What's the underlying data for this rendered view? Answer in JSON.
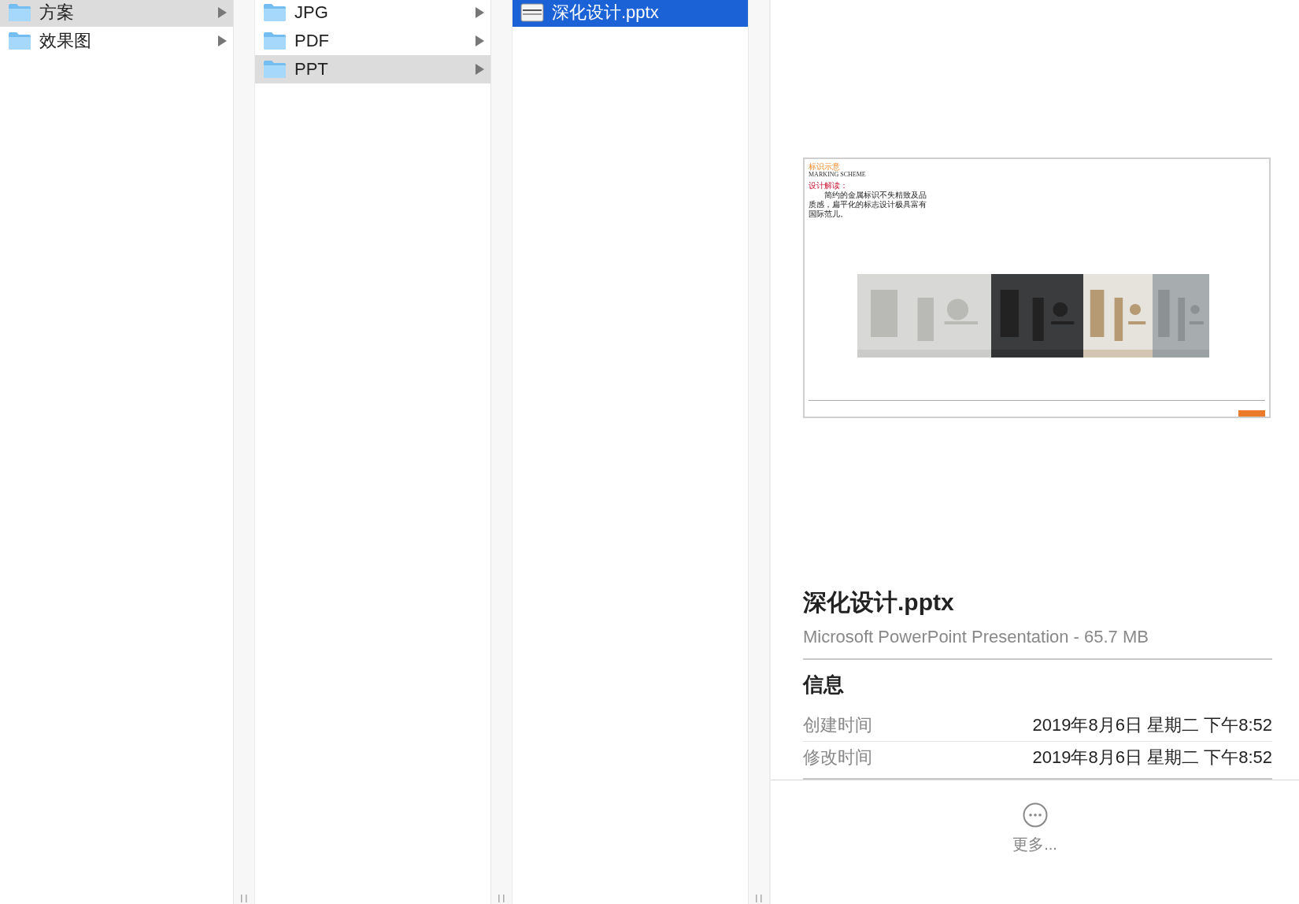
{
  "columns": [
    {
      "focused": false,
      "items": [
        {
          "kind": "folder",
          "name": "方案",
          "selected": true
        },
        {
          "kind": "folder",
          "name": "效果图",
          "selected": false
        }
      ]
    },
    {
      "focused": false,
      "items": [
        {
          "kind": "folder",
          "name": "JPG",
          "selected": false
        },
        {
          "kind": "folder",
          "name": "PDF",
          "selected": false
        },
        {
          "kind": "folder",
          "name": "PPT",
          "selected": true
        }
      ]
    },
    {
      "focused": true,
      "items": [
        {
          "kind": "file",
          "name": "深化设计.pptx",
          "selected": true
        }
      ]
    }
  ],
  "preview": {
    "slide": {
      "heading": "标识示意",
      "subheading": "MARKING SCHEME",
      "label": "设计解读：",
      "body": "简约的金属标识不失精致及品质感，扁平化的标志设计极具富有国际范儿。"
    },
    "title": "深化设计.pptx",
    "subtitle": "Microsoft PowerPoint Presentation - 65.7 MB",
    "info": {
      "heading": "信息",
      "rows": [
        {
          "label": "创建时间",
          "value": "2019年8月6日 星期二 下午8:52"
        },
        {
          "label": "修改时间",
          "value": "2019年8月6日 星期二 下午8:52"
        }
      ]
    },
    "more": "更多..."
  }
}
